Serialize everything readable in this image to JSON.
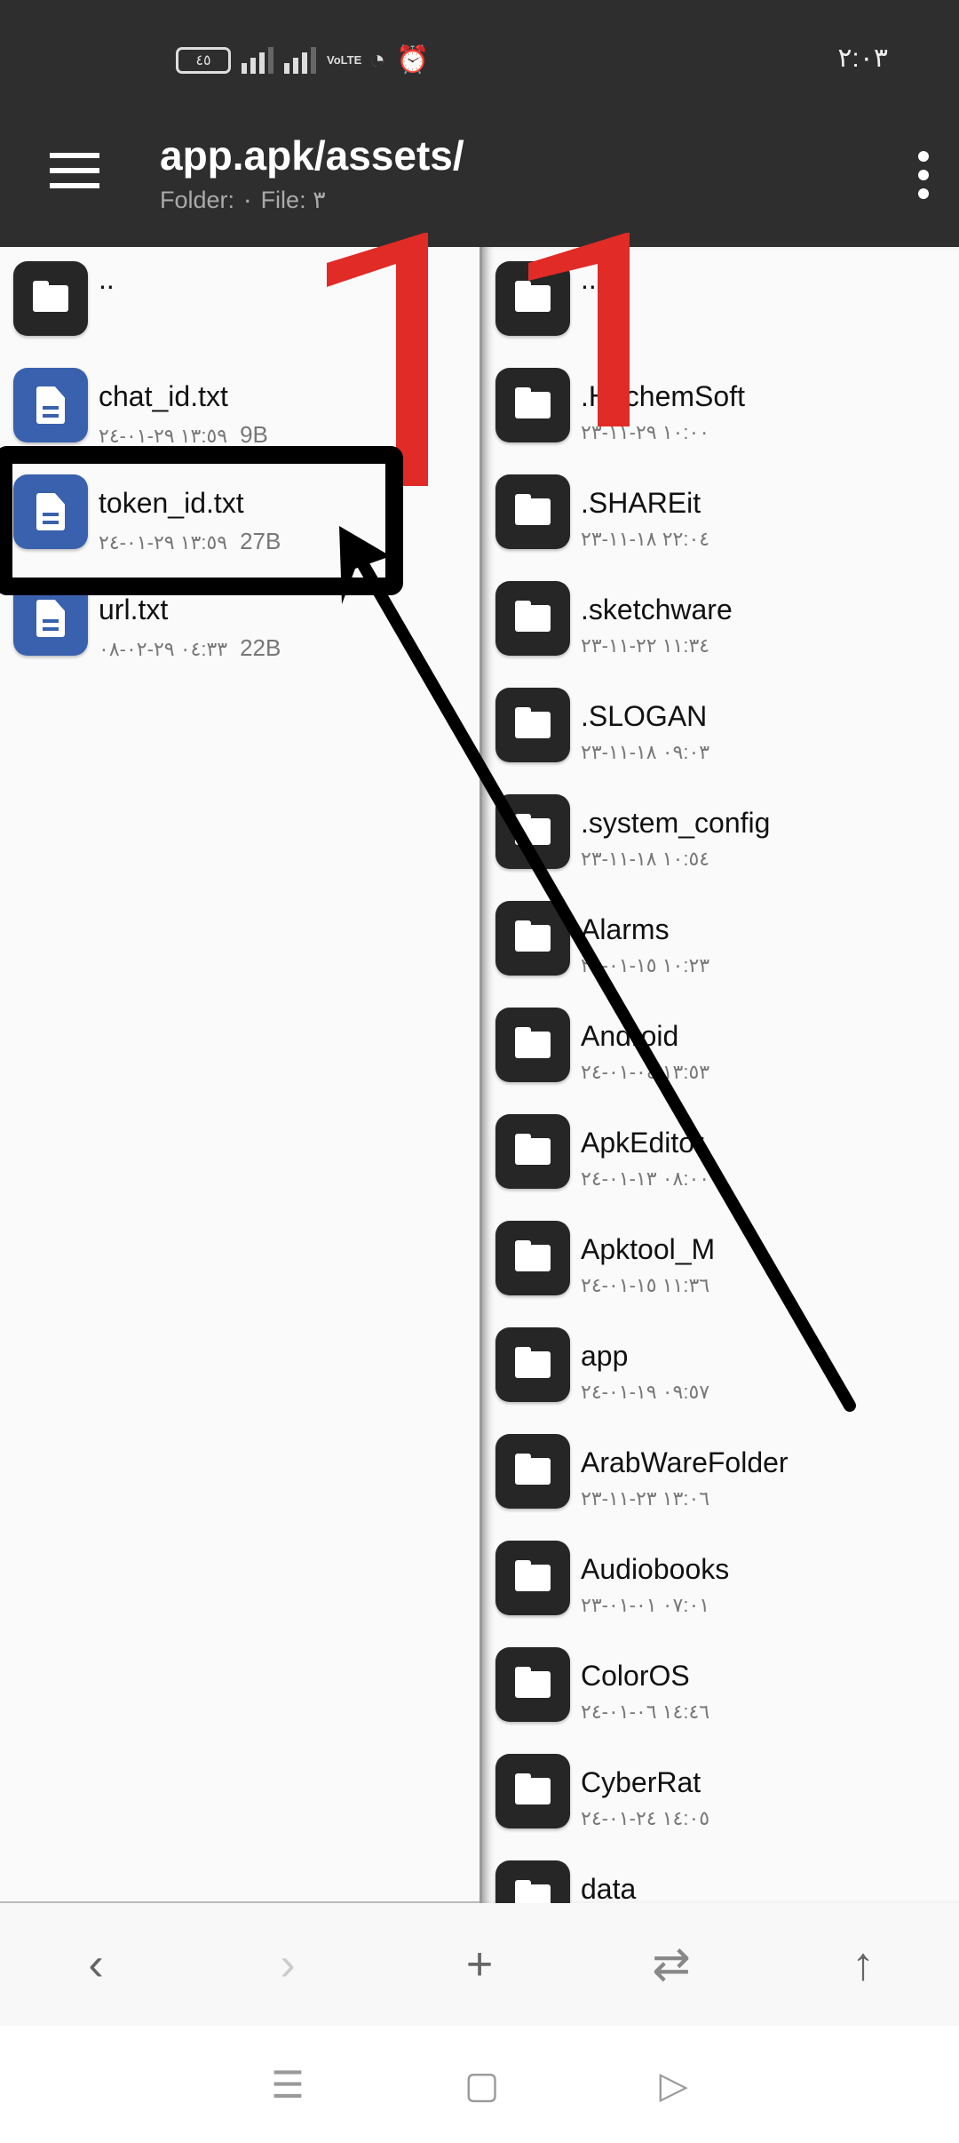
{
  "status_bar": {
    "battery": "٤٥",
    "time": "٢:٠٣",
    "volte": "VoLTE"
  },
  "toolbar": {
    "title": "app.apk/assets/",
    "subtitle": "Folder: ٠  File: ٣"
  },
  "left_panel": {
    "items": [
      {
        "name": "..",
        "type": "folder",
        "date": "",
        "size": ""
      },
      {
        "name": "chat_id.txt",
        "type": "file",
        "date": "١٣:٥٩ ٢٩-٠١-٢٤",
        "size": "9B"
      },
      {
        "name": "token_id.txt",
        "type": "file",
        "date": "١٣:٥٩ ٢٩-٠١-٢٤",
        "size": "27B"
      },
      {
        "name": "url.txt",
        "type": "file",
        "date": "٠٤:٣٣ ٢٩-٠٢-٠٨",
        "size": "22B"
      }
    ]
  },
  "right_panel": {
    "items": [
      {
        "name": "..",
        "date": ""
      },
      {
        "name": ".HachemSoft",
        "date": "١٠:٠٠ ٢٩-١١-٢٣"
      },
      {
        "name": ".SHAREit",
        "date": "٢٢:٠٤ ١٨-١١-٢٣"
      },
      {
        "name": ".sketchware",
        "date": "١١:٣٤ ٢٢-١١-٢٣"
      },
      {
        "name": ".SLOGAN",
        "date": "٠٩:٠٣ ١٨-١١-٢٣"
      },
      {
        "name": ".system_config",
        "date": "١٠:٥٤ ١٨-١١-٢٣"
      },
      {
        "name": "Alarms",
        "date": "١٠:٢٣ ١٥-٠١-٢٤"
      },
      {
        "name": "Android",
        "date": "١٣:٥٣ ٠٤-٠١-٢٤"
      },
      {
        "name": "ApkEditor",
        "date": "٠٨:٠٠ ١٣-٠١-٢٤"
      },
      {
        "name": "Apktool_M",
        "date": "١١:٣٦ ١٥-٠١-٢٤"
      },
      {
        "name": "app",
        "date": "٠٩:٥٧ ١٩-٠١-٢٤"
      },
      {
        "name": "ArabWareFolder",
        "date": "١٣:٠٦ ٢٣-١١-٢٣"
      },
      {
        "name": "Audiobooks",
        "date": "٠٧:٠١ ٠١-٠١-٢٣"
      },
      {
        "name": "ColorOS",
        "date": "١٤:٤٦ ٠٦-٠١-٢٤"
      },
      {
        "name": "CyberRat",
        "date": "١٤:٠٥ ٢٤-٠١-٢٤"
      },
      {
        "name": "data",
        "date": ""
      }
    ]
  },
  "bottom_bar": {
    "back": "‹",
    "forward": "›",
    "add": "+",
    "swap": "⇄",
    "up": "↑"
  },
  "nav_bar": {
    "recents": "☰",
    "home": "▢",
    "back": "▷"
  },
  "colors": {
    "toolbar": "#2e2e2e",
    "file_icon": "#3a61ad",
    "folder_icon": "#262626",
    "annotation_red": "#e02b27",
    "annotation_black": "#000000"
  }
}
